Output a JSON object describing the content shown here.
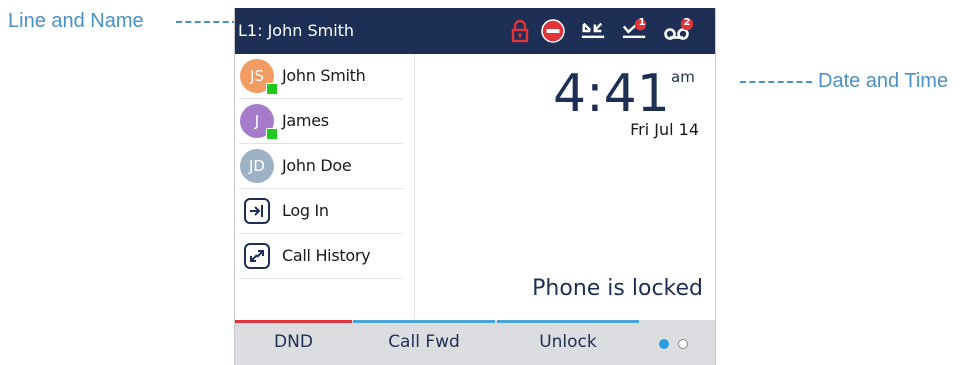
{
  "callouts": {
    "line_and_name": "Line and Name",
    "date_and_time": "Date and Time"
  },
  "topbar": {
    "line_label": "L1: John Smith",
    "status_icons": [
      "lock-icon",
      "do-not-disturb-icon",
      "missed-calls-icon",
      "messages-icon",
      "voicemail-icon"
    ],
    "badges": {
      "messages": "1",
      "voicemail": "2"
    }
  },
  "contacts": [
    {
      "initials": "JS",
      "name": "John Smith",
      "avatar_color": "#f29c63",
      "online": true
    },
    {
      "initials": "J",
      "name": "James",
      "avatar_color": "#a67bc9",
      "online": true
    },
    {
      "initials": "JD",
      "name": "John Doe",
      "avatar_color": "#9db3c5",
      "online": false
    }
  ],
  "actions": [
    {
      "label": "Log In",
      "icon": "login-icon"
    },
    {
      "label": "Call History",
      "icon": "call-history-icon"
    }
  ],
  "clock": {
    "time": "4:41",
    "ampm": "am",
    "date": "Fri Jul 14"
  },
  "status_message": "Phone is locked",
  "softkeys": [
    {
      "label": "DND",
      "accent": "#e0343a"
    },
    {
      "label": "Call Fwd",
      "accent": "#4aa3d9"
    },
    {
      "label": "Unlock",
      "accent": "#4aa3d9"
    }
  ],
  "pager": {
    "current": 1,
    "total": 2
  },
  "colors": {
    "header_bg": "#1d2f55",
    "accent_red": "#e0343a",
    "callout_blue": "#4a90c8",
    "presence_green": "#1ec81e",
    "softkey_bg": "#dcdde0"
  }
}
